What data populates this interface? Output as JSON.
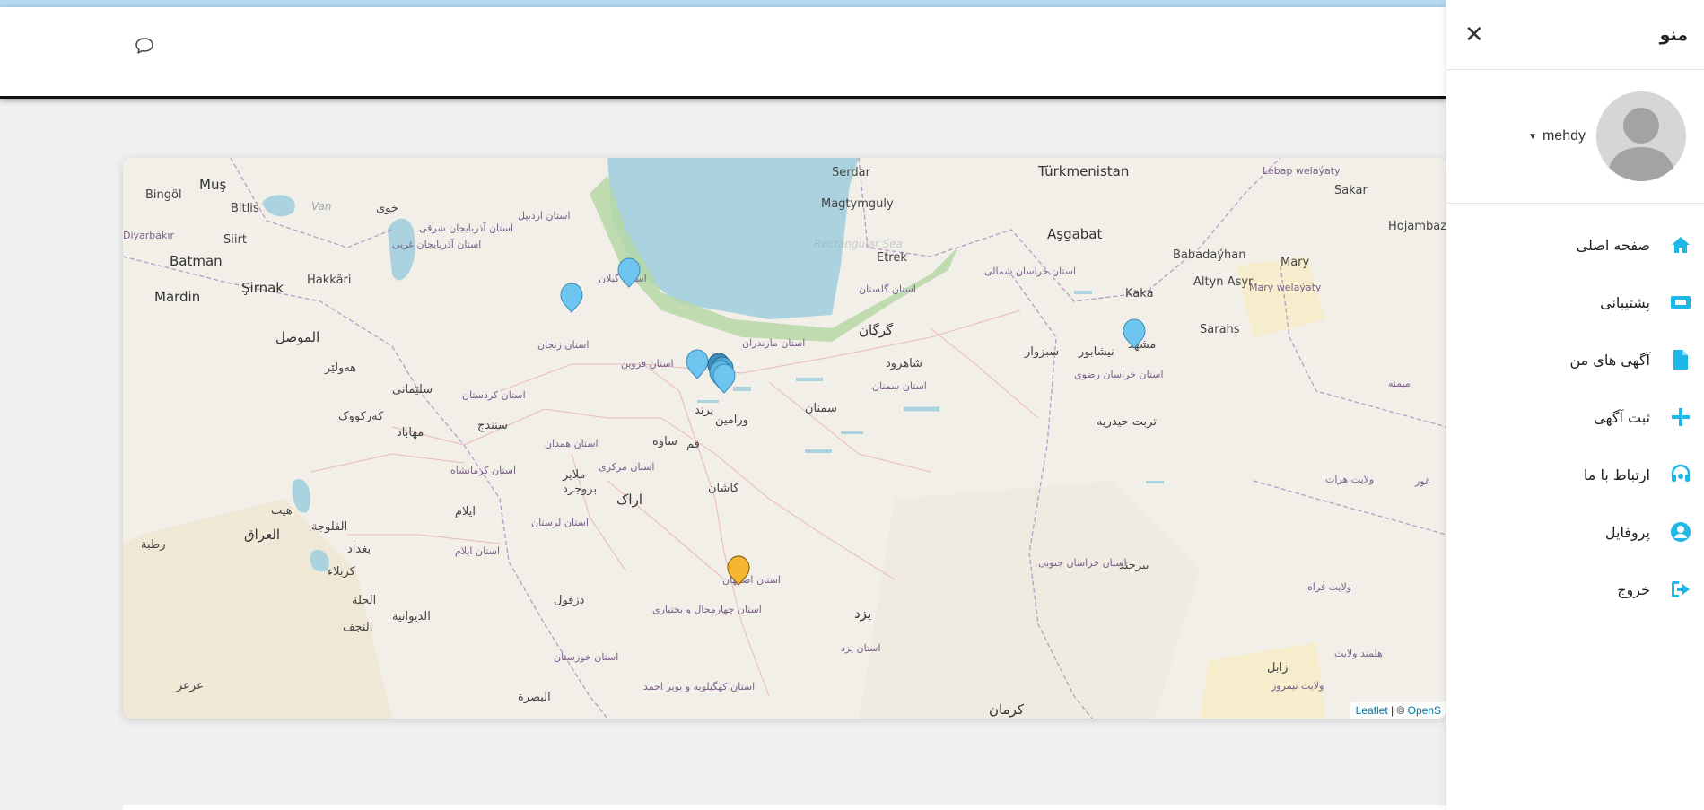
{
  "header": {
    "chat_icon": "chat-bubble-icon"
  },
  "map": {
    "attribution_leaflet": "Leaflet",
    "attribution_sep": " | © ",
    "attribution_osm": "OpenS",
    "overlay_text": "Rectangular Sea",
    "labels": {
      "turkmenistan": "Türkmenistan",
      "ashgabat": "Aşgabat",
      "serdar": "Serdar",
      "magtymguly": "Magtymguly",
      "etrek": "Etrek",
      "lebap": "Lebap welaýaty",
      "sakar": "Sakar",
      "hojambaz": "Hojambaz",
      "babadayhan": "Babadaýhan",
      "mary": "Mary",
      "altyn_asyr": "Altyn Asyr",
      "mary_welayaty": "Mary welaýaty",
      "kaka": "Kaka",
      "sarahs": "Sarahs",
      "mus": "Muş",
      "bingol": "Bingöl",
      "bitlis": "Bitlis",
      "van": "Van",
      "diyarbakir": "Diyarbakır",
      "siirt": "Siirt",
      "batman": "Batman",
      "sirnak": "Şirnak",
      "hakkari": "Hakkâri",
      "mardin": "Mardin",
      "mosul": "الموصل",
      "erbil": "هەولێر",
      "sulaymaniyah": "سلێمانی",
      "kirkuk": "کەرکووک",
      "baghdad": "بغداد",
      "karbala": "كربلاء",
      "hillah": "الحلة",
      "najaf": "النجف",
      "diwaniyah": "الديوانية",
      "iraq": "العراق",
      "hit": "هيت",
      "rutba": "رطبة",
      "fallujah": "الفلوجة",
      "basra": "البصرة",
      "ararak": "عرعر",
      "sanandaj": "سنندج",
      "arak": "اراک",
      "qom": "قم",
      "kashan": "کاشان",
      "semnan": "سمنان",
      "gorgan": "گرگان",
      "shahroud": "شاهرود",
      "sabzevar": "سبزوار",
      "neyshabur": "نیشابور",
      "mashhad": "مشهد",
      "birjand": "بیرجند",
      "yazd": "یزد",
      "kerman": "کرمان",
      "zabol": "زابل",
      "herat": "ولایت هرات",
      "farah": "ولایت فراه",
      "ghor": "غور",
      "helmand": "هلمند ولایت",
      "nimroz": "ولایت نیمروز",
      "meymaneh": "میمنه",
      "torbat": "تربت حیدریه",
      "varamin": "ورامین",
      "saveh": "ساوه",
      "dezful": "دزفول",
      "ilam": "ایلام",
      "borujerd": "بروجرد",
      "malayer": "ملایر",
      "khoy": "خوی",
      "mahabad": "مهاباد",
      "urmia_region": "استان آذربایجان غربی",
      "east_azerbaijan": "استان آذربایجان شرقی",
      "ardabil": "استان اردبیل",
      "zanjan": "استان زنجان",
      "qazvin": "استان قزوین",
      "kurdistan": "استان کردستان",
      "hamadan": "استان همدان",
      "kermanshah": "استان کرمانشاه",
      "markazi": "استان مرکزی",
      "lorestan": "استان لرستان",
      "ilam_prov": "استان ایلام",
      "khuzestan": "استان خوزستان",
      "isfahan": "استان اصفهان",
      "chaharmahal": "استان چهارمحال و بختیاری",
      "kohgiluyeh": "استان کهگیلویه و بویر احمد",
      "yazd_prov": "استان یزد",
      "semnan_prov": "استان سمنان",
      "mazandaran": "استان مازندران",
      "golestan": "استان گلستان",
      "north_khorasan": "استان خراسان شمالی",
      "razavi": "استان خراسان رضوی",
      "south_khorasan": "استان خراسان جنوبی",
      "gilan": "استان گیلان",
      "pardis": "پرند"
    }
  },
  "menu": {
    "title": "منو",
    "close_icon": "close-icon",
    "user": {
      "name": "mehdy"
    },
    "items": [
      {
        "label": "صفحه اصلی",
        "icon": "home-icon"
      },
      {
        "label": "پشتیبانی",
        "icon": "ticket-icon"
      },
      {
        "label": "آگهی های من",
        "icon": "file-icon"
      },
      {
        "label": "ثبت آگهی",
        "icon": "plus-icon"
      },
      {
        "label": "ارتباط با ما",
        "icon": "headset-icon"
      },
      {
        "label": "پروفایل",
        "icon": "user-circle-icon"
      },
      {
        "label": "خروج",
        "icon": "sign-out-icon"
      }
    ],
    "accent": "#1fb6e8"
  }
}
